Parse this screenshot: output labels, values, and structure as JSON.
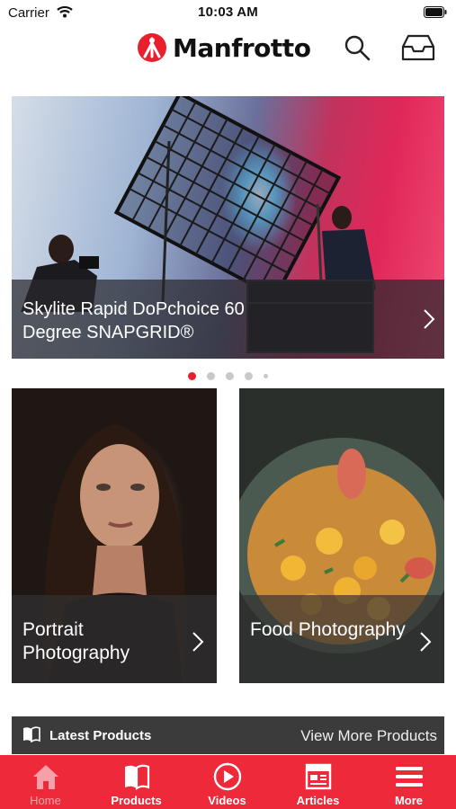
{
  "status_bar": {
    "carrier": "Carrier",
    "time": "10:03 AM"
  },
  "header": {
    "brand": "Manfrotto"
  },
  "hero": {
    "title": "Skylite Rapid DoPchoice 60 Degree SNAPGRID®",
    "slide_count": 5,
    "active_slide": 1
  },
  "tiles": [
    {
      "title": "Portrait Photography"
    },
    {
      "title": "Food Photography"
    }
  ],
  "latest": {
    "label": "Latest Products",
    "link": "View More Products"
  },
  "tabbar": {
    "items": [
      {
        "label": "Home",
        "icon": "home-icon"
      },
      {
        "label": "Products",
        "icon": "products-icon"
      },
      {
        "label": "Videos",
        "icon": "play-icon"
      },
      {
        "label": "Articles",
        "icon": "articles-icon"
      },
      {
        "label": "More",
        "icon": "menu-icon"
      }
    ],
    "active": "Home"
  },
  "colors": {
    "accent": "#ee2a3a",
    "dark_bar": "#3b3b3b",
    "dot_active": "#e8202e"
  }
}
